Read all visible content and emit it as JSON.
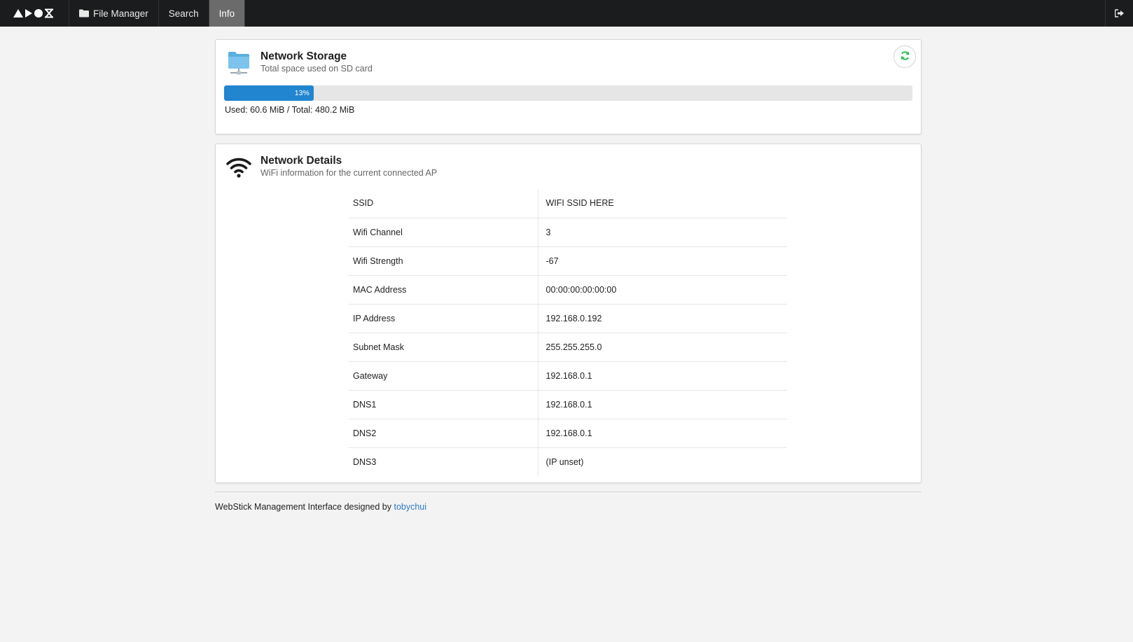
{
  "topbar": {
    "logo_icon": "arozos-logo-icon",
    "items": [
      {
        "label": "File Manager",
        "icon": "folder-icon",
        "active": false
      },
      {
        "label": "Search",
        "active": false
      },
      {
        "label": "Info",
        "active": true
      }
    ],
    "logout_icon": "sign-out-icon"
  },
  "storage": {
    "title": "Network Storage",
    "subtitle": "Total space used on SD card",
    "percent": 13,
    "percent_label": "13%",
    "usage_text": "Used: 60.6 MiB / Total: 480.2 MiB",
    "progress_color": "#2185d0"
  },
  "details": {
    "title": "Network Details",
    "subtitle": "WiFi information for the current connected AP",
    "rows": [
      {
        "key": "SSID",
        "value": "WIFI SSID HERE"
      },
      {
        "key": "Wifi Channel",
        "value": "3"
      },
      {
        "key": "Wifi Strength",
        "value": "-67"
      },
      {
        "key": "MAC Address",
        "value": "00:00:00:00:00:00"
      },
      {
        "key": "IP Address",
        "value": "192.168.0.192"
      },
      {
        "key": "Subnet Mask",
        "value": "255.255.255.0"
      },
      {
        "key": "Gateway",
        "value": "192.168.0.1"
      },
      {
        "key": "DNS1",
        "value": "192.168.0.1"
      },
      {
        "key": "DNS2",
        "value": "192.168.0.1"
      },
      {
        "key": "DNS3",
        "value": "(IP unset)"
      }
    ]
  },
  "footer": {
    "text": "WebStick Management Interface designed by ",
    "link_text": "tobychui"
  }
}
